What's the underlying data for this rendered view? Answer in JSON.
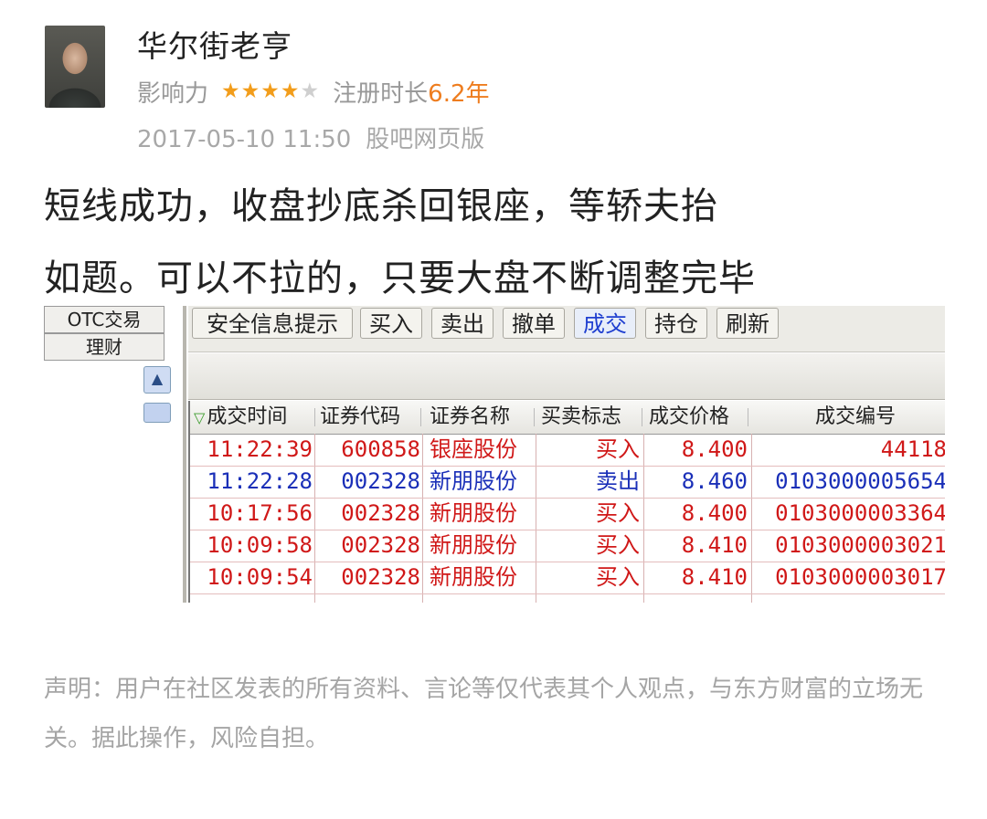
{
  "author": {
    "name": "华尔街老亨",
    "influence_label": "影响力",
    "rating_stars": 4,
    "rating_max": 5,
    "reg_label": "注册时长",
    "reg_value": "6.2年"
  },
  "post": {
    "datetime": "2017-05-10 11:50",
    "source": "股吧网页版",
    "title": "短线成功，收盘抄底杀回银座，等轿夫抬",
    "body": "如题。可以不拉的，只要大盘不断调整完毕"
  },
  "screenshot": {
    "side_buttons": [
      "OTC交易",
      "理财"
    ],
    "toolbar": [
      "安全信息提示",
      "买入",
      "卖出",
      "撤单",
      "成交",
      "持仓",
      "刷新"
    ],
    "active_tab": "成交",
    "columns": [
      "成交时间",
      "证券代码",
      "证券名称",
      "买卖标志",
      "成交价格",
      "成交编号"
    ],
    "rows": [
      {
        "time": "11:22:39",
        "code": "600858",
        "name": "银座股份",
        "side": "买入",
        "price": "8.400",
        "id": "44118",
        "color": "#d01818"
      },
      {
        "time": "11:22:28",
        "code": "002328",
        "name": "新朋股份",
        "side": "卖出",
        "price": "8.460",
        "id": "0103000005654",
        "color": "#1a2fb8"
      },
      {
        "time": "10:17:56",
        "code": "002328",
        "name": "新朋股份",
        "side": "买入",
        "price": "8.400",
        "id": "0103000003364",
        "color": "#d01818"
      },
      {
        "time": "10:09:58",
        "code": "002328",
        "name": "新朋股份",
        "side": "买入",
        "price": "8.410",
        "id": "0103000003021",
        "color": "#d01818"
      },
      {
        "time": "10:09:54",
        "code": "002328",
        "name": "新朋股份",
        "side": "买入",
        "price": "8.410",
        "id": "0103000003017",
        "color": "#d01818"
      }
    ]
  },
  "disclaimer": "声明：用户在社区发表的所有资料、言论等仅代表其个人观点，与东方财富的立场无关。据此操作，风险自担。",
  "colors": {
    "star": "#f29d1b",
    "reg_value": "#ee7d1f",
    "buy": "#d01818",
    "sell": "#1a2fb8"
  }
}
